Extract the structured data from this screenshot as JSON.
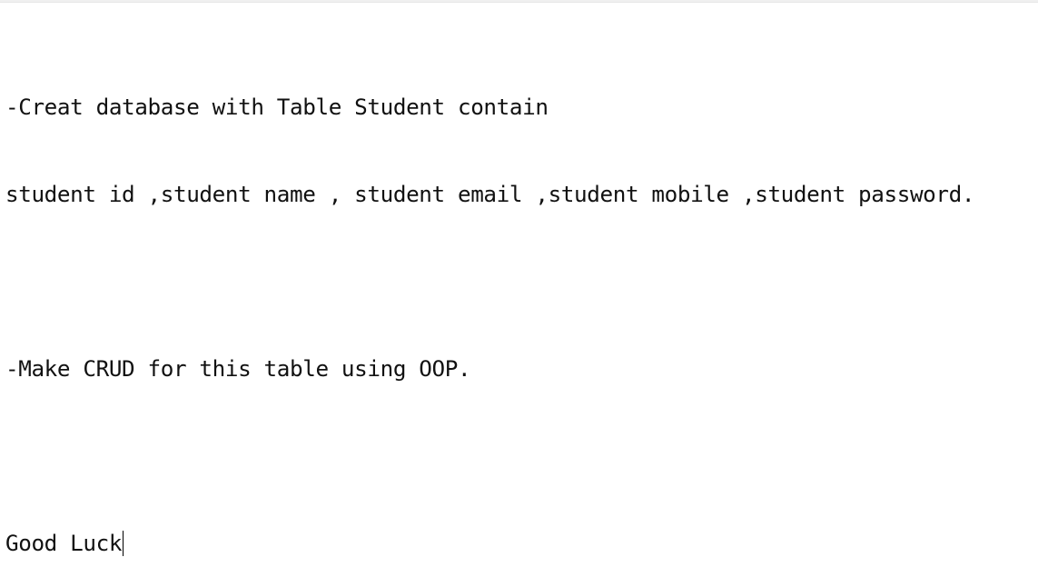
{
  "document": {
    "lines": [
      "-Creat database with Table Student contain",
      "student id ,student name , student email ,student mobile ,student password.",
      "",
      "-Make CRUD for this table using OOP.",
      "",
      "Good Luck"
    ]
  }
}
